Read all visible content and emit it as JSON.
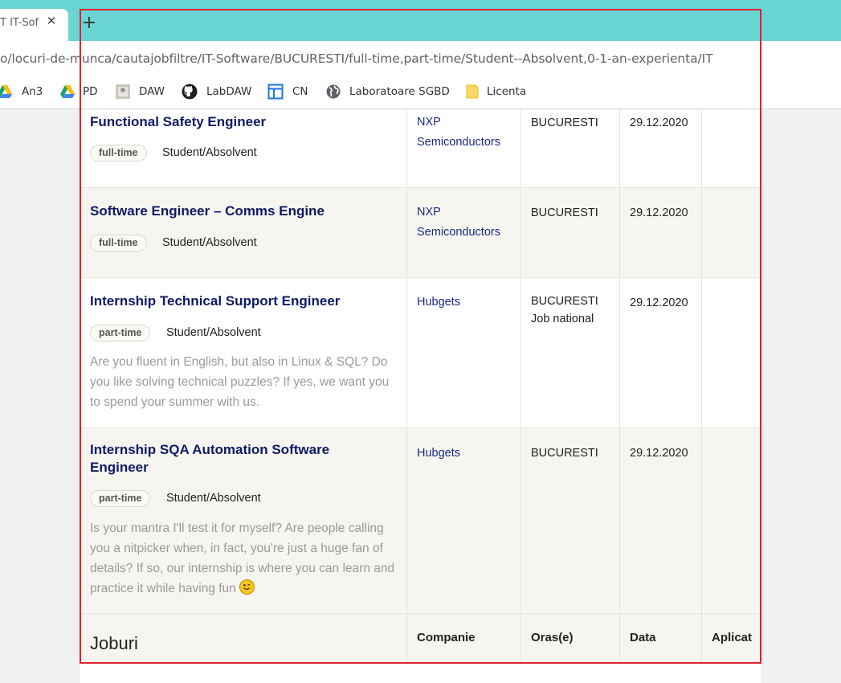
{
  "browser": {
    "tab_title": "T IT-Sof",
    "new_tab_symbol": "+",
    "url": "o/locuri-de-munca/cautajobfiltre/IT-Software/BUCURESTI/full-time,part-time/Student--Absolvent,0-1-an-experienta/IT",
    "bookmarks": [
      {
        "label": "An3",
        "icon": "google-drive-icon"
      },
      {
        "label": "PD",
        "icon": "google-drive-icon"
      },
      {
        "label": "DAW",
        "icon": "image-thumbnail-icon"
      },
      {
        "label": "LabDAW",
        "icon": "github-icon"
      },
      {
        "label": "CN",
        "icon": "table-icon"
      },
      {
        "label": "Laboratoare SGBD",
        "icon": "globe-icon"
      },
      {
        "label": "Licenta",
        "icon": "sticky-note-icon"
      }
    ]
  },
  "jobs": [
    {
      "title": "Functional Safety Engineer",
      "type": "full-time",
      "level": "Student/Absolvent",
      "description": "",
      "company": "NXP Semiconductors",
      "cities": [
        "BUCURESTI"
      ],
      "date": "29.12.2020"
    },
    {
      "title": "Software Engineer – Comms Engine",
      "type": "full-time",
      "level": "Student/Absolvent",
      "description": "",
      "company": "NXP Semiconductors",
      "cities": [
        "BUCURESTI"
      ],
      "date": "29.12.2020"
    },
    {
      "title": "Internship Technical Support Engineer",
      "type": "part-time",
      "level": "Student/Absolvent",
      "description": "Are you fluent in English, but also in Linux & SQL? Do you like solving technical puzzles? If yes, we want you to spend your summer with us.",
      "company": "Hubgets",
      "cities": [
        "BUCURESTI",
        "Job national"
      ],
      "date": "29.12.2020"
    },
    {
      "title": "Internship SQA Automation Software Engineer",
      "type": "part-time",
      "level": "Student/Absolvent",
      "description": "Is your mantra I'll test it for myself? Are people calling you a nitpicker when, in fact, you're just a huge fan of details? If so, our internship is where you can learn and practice it while having fun",
      "company": "Hubgets",
      "cities": [
        "BUCURESTI"
      ],
      "date": "29.12.2020"
    }
  ],
  "table_footer": {
    "title": "Joburi",
    "col_company": "Companie",
    "col_city": "Oras(e)",
    "col_date": "Data",
    "col_apply": "Aplicat"
  },
  "colors": {
    "tabbar": "#69d5d5",
    "job_title": "#0d1a66",
    "company_link": "#1a2a80",
    "selection_border": "#e0202a"
  }
}
